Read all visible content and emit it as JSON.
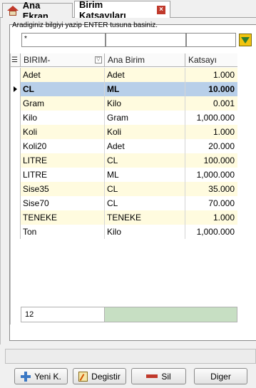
{
  "tabs": [
    {
      "label": "Ana Ekran",
      "icon": "home-icon"
    },
    {
      "label": "Birim Katsayıları",
      "icon": "close-icon"
    }
  ],
  "search": {
    "hint": "Aradiginiz bilgiyi yazip ENTER tusuna basiniz.",
    "filter1_value": "*",
    "filter2_value": "",
    "filter3_value": ""
  },
  "grid": {
    "columns": [
      "BIRIM-",
      "Ana Birim",
      "Katsayı"
    ],
    "rows": [
      {
        "birim": "Adet",
        "ana_birim": "Adet",
        "katsayi": "1.000"
      },
      {
        "birim": "CL",
        "ana_birim": "ML",
        "katsayi": "10.000"
      },
      {
        "birim": "Gram",
        "ana_birim": "Kilo",
        "katsayi": "0.001"
      },
      {
        "birim": "Kilo",
        "ana_birim": "Gram",
        "katsayi": "1,000.000"
      },
      {
        "birim": "Koli",
        "ana_birim": "Koli",
        "katsayi": "1.000"
      },
      {
        "birim": "Koli20",
        "ana_birim": "Adet",
        "katsayi": "20.000"
      },
      {
        "birim": "LITRE",
        "ana_birim": "CL",
        "katsayi": "100.000"
      },
      {
        "birim": "LITRE",
        "ana_birim": "ML",
        "katsayi": "1,000.000"
      },
      {
        "birim": "Sise35",
        "ana_birim": "CL",
        "katsayi": "35.000"
      },
      {
        "birim": "Sise70",
        "ana_birim": "CL",
        "katsayi": "70.000"
      },
      {
        "birim": "TENEKE",
        "ana_birim": "TENEKE",
        "katsayi": "1.000"
      },
      {
        "birim": "Ton",
        "ana_birim": "Kilo",
        "katsayi": "1,000.000"
      }
    ],
    "selected_index": 1,
    "record_count": "12"
  },
  "buttons": {
    "new_label": "Yeni K.",
    "edit_label": "Degistir",
    "delete_label": "Sil",
    "other_label": "Diger"
  },
  "colors": {
    "row_odd": "#fffbdf",
    "row_selected": "#b8cfe9",
    "footer_green": "#c7dfc3"
  }
}
